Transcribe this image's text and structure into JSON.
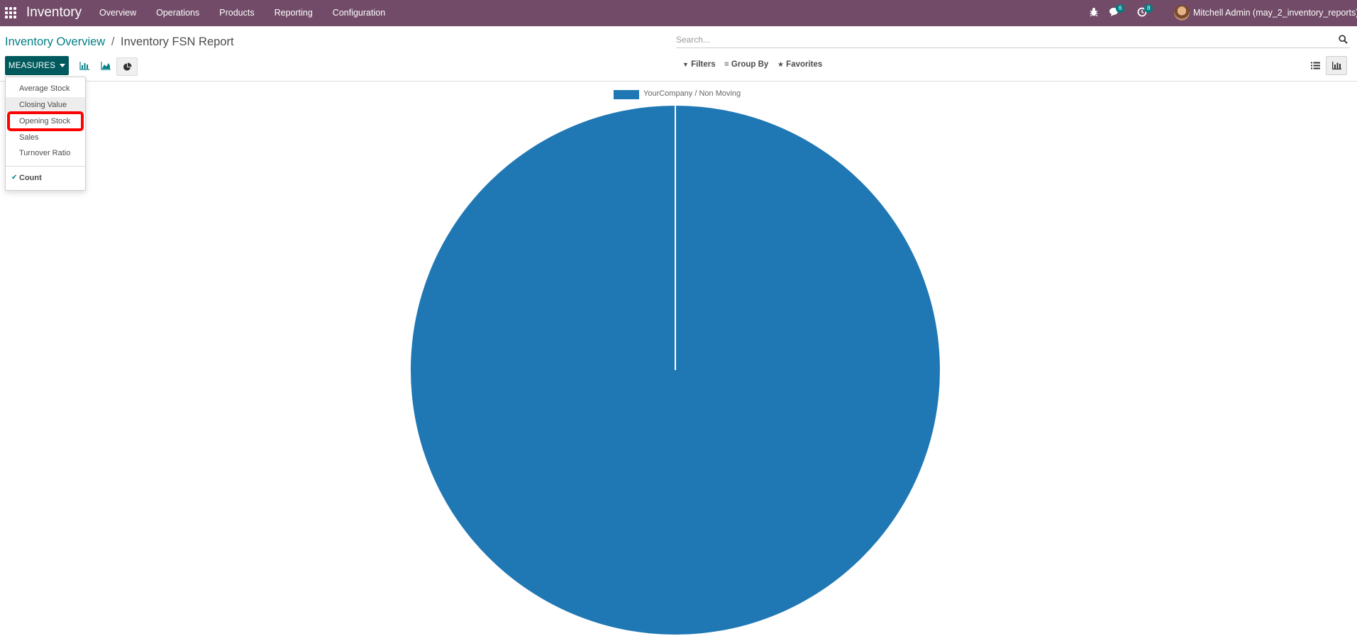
{
  "navbar": {
    "brand": "Inventory",
    "menu": [
      "Overview",
      "Operations",
      "Products",
      "Reporting",
      "Configuration"
    ],
    "messages_badge": "6",
    "activities_badge": "8",
    "user": "Mitchell Admin (may_2_inventory_reports)",
    "icons": [
      "apps-grid-icon",
      "bug-icon",
      "chat-icon",
      "clock-icon"
    ]
  },
  "breadcrumb": {
    "parent": "Inventory Overview",
    "separator": "/",
    "current": "Inventory FSN Report"
  },
  "search": {
    "placeholder": "Search..."
  },
  "toolbar": {
    "measures_label": "MEASURES",
    "filters_label": "Filters",
    "groupby_label": "Group By",
    "favorites_label": "Favorites"
  },
  "measures_menu": {
    "items": [
      "Average Stock",
      "Closing Value",
      "Opening Stock",
      "Sales",
      "Turnover Ratio"
    ],
    "hovered": "Closing Value",
    "highlighted": "Opening Stock",
    "checked_item": "Count"
  },
  "colors": {
    "navbar": "#714b67",
    "accent": "#017e84",
    "primary_button": "#00595c",
    "series": "#1f77b4",
    "highlight": "#ff0000"
  },
  "chart_data": {
    "type": "pie",
    "legend": [
      "YourCompany / Non Moving"
    ],
    "slices": [
      {
        "label": "YourCompany / Non Moving",
        "value": 100
      }
    ],
    "legend_position": "top-center"
  }
}
